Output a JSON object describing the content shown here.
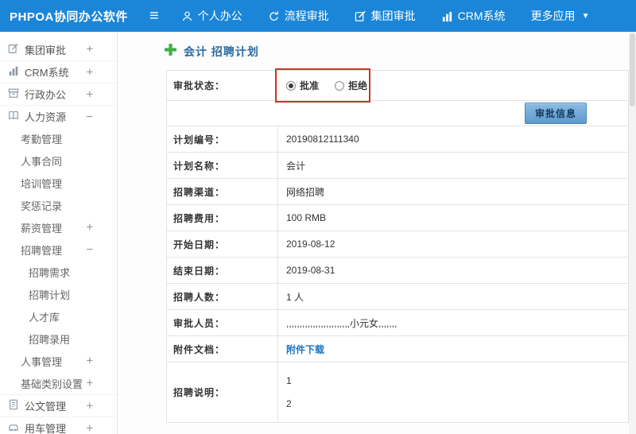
{
  "topbar": {
    "logo": "PHPOA协同办公软件",
    "nav": [
      {
        "label": "个人办公"
      },
      {
        "label": "流程审批"
      },
      {
        "label": "集团审批"
      },
      {
        "label": "CRM系统"
      },
      {
        "label": "更多应用"
      }
    ]
  },
  "sidebar": {
    "items": [
      {
        "label": "集团审批",
        "expand": "+"
      },
      {
        "label": "CRM系统",
        "expand": "+"
      },
      {
        "label": "行政办公",
        "expand": "+"
      },
      {
        "label": "人力资源",
        "expand": "−"
      },
      {
        "label": "考勤管理",
        "expand": ""
      },
      {
        "label": "人事合同",
        "expand": ""
      },
      {
        "label": "培训管理",
        "expand": ""
      },
      {
        "label": "奖惩记录",
        "expand": ""
      },
      {
        "label": "薪资管理",
        "expand": "+"
      },
      {
        "label": "招聘管理",
        "expand": "−"
      },
      {
        "label": "招聘需求",
        "expand": ""
      },
      {
        "label": "招聘计划",
        "expand": ""
      },
      {
        "label": "人才库",
        "expand": ""
      },
      {
        "label": "招聘录用",
        "expand": ""
      },
      {
        "label": "人事管理",
        "expand": "+"
      },
      {
        "label": "基础类别设置",
        "expand": "+"
      },
      {
        "label": "公文管理",
        "expand": "+"
      },
      {
        "label": "用车管理",
        "expand": "+"
      }
    ]
  },
  "main": {
    "title": "会计 招聘计划",
    "status": {
      "label": "审批状态：",
      "approve": "批准",
      "reject": "拒绝"
    },
    "approve_button": "审批信息",
    "rows": [
      {
        "label": "计划编号：",
        "value": "20190812111340"
      },
      {
        "label": "计划名称：",
        "value": "会计"
      },
      {
        "label": "招聘渠道：",
        "value": "网络招聘"
      },
      {
        "label": "招聘费用：",
        "value": "100 RMB"
      },
      {
        "label": "开始日期：",
        "value": "2019-08-12"
      },
      {
        "label": "结束日期：",
        "value": "2019-08-31"
      },
      {
        "label": "招聘人数：",
        "value": "1 人"
      },
      {
        "label": "审批人员：",
        "value": ",,,,,,,,,,,,,,,,,,,,,,,,小元女,,,,,,,"
      },
      {
        "label": "附件文档：",
        "value": "附件下载"
      },
      {
        "label": "招聘说明：",
        "lines": [
          "1",
          "2"
        ]
      }
    ]
  },
  "colors": {
    "topbar": "#1b86d8",
    "title": "#2b6ca3",
    "annotation": "#c0392b",
    "link": "#1f74c0",
    "plus_icon_green": "#3fae49"
  }
}
